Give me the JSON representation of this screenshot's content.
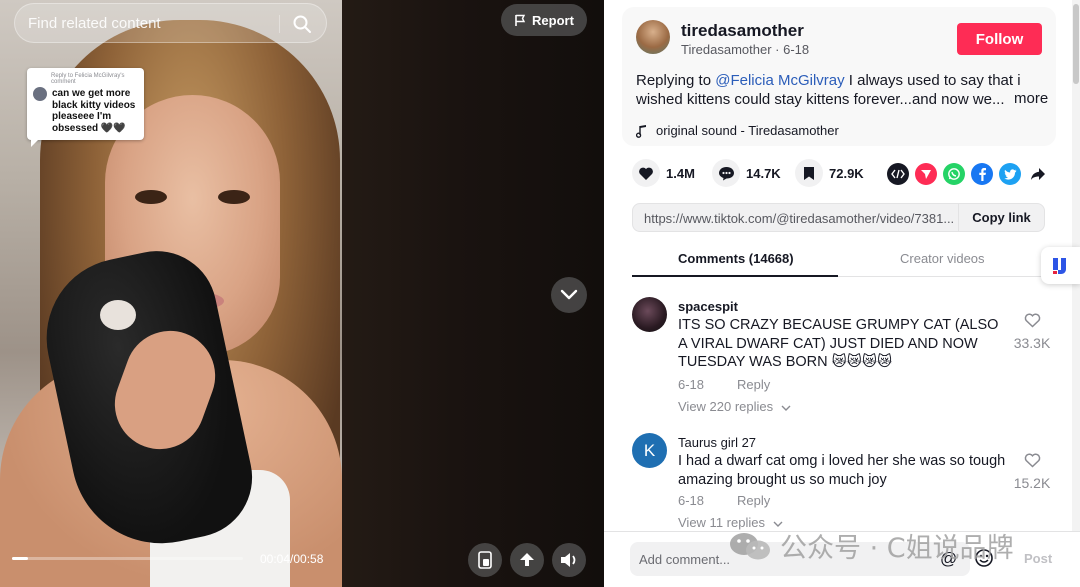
{
  "video": {
    "search_placeholder": "Find related content",
    "report_label": "Report",
    "reply_header": "Reply to Felicia McGilvray's comment",
    "reply_text": "can we get more black kitty videos pleaseee I'm obsessed 🖤🖤",
    "time": "00:04/00:58",
    "progress": 0.069
  },
  "author": {
    "name": "tiredasamother",
    "subtitle": "Tiredasamother · 6-18",
    "follow_label": "Follow",
    "desc_prefix": "Replying to ",
    "desc_mention": "@Felicia McGilvray",
    "desc_rest": " I always used to say that i wished kittens could stay kittens forever...and now we...",
    "more_label": "more",
    "sound": "original sound - Tiredasamother"
  },
  "actions": {
    "likes": "1.4M",
    "comments": "14.7K",
    "saves": "72.9K"
  },
  "link": {
    "url": "https://www.tiktok.com/@tiredasamother/video/7381...",
    "copy_label": "Copy link"
  },
  "tabs": {
    "comments": "Comments (14668)",
    "creator": "Creator videos"
  },
  "comments": [
    {
      "user": "spacespit",
      "text": "ITS SO CRAZY BECAUSE GRUMPY CAT (ALSO A VIRAL DWARF CAT) JUST DIED AND NOW TUESDAY WAS BORN 😿😿😿😿",
      "date": "6-18",
      "reply": "Reply",
      "view_replies": "View 220 replies",
      "likes": "33.3K"
    },
    {
      "user": "Taurus girl 27",
      "avatar_letter": "K",
      "text": "I had a dwarf cat omg i loved her she was so tough amazing brought us so much joy",
      "date": "6-18",
      "reply": "Reply",
      "view_replies": "View 11 replies",
      "likes": "15.2K"
    }
  ],
  "composer": {
    "placeholder": "Add comment...",
    "at_symbol": "@",
    "post_label": "Post"
  },
  "watermark": {
    "text": "公众号 · C姐说品牌"
  },
  "colors": {
    "brand": "#fe2c55",
    "mention": "#2b5db9"
  }
}
